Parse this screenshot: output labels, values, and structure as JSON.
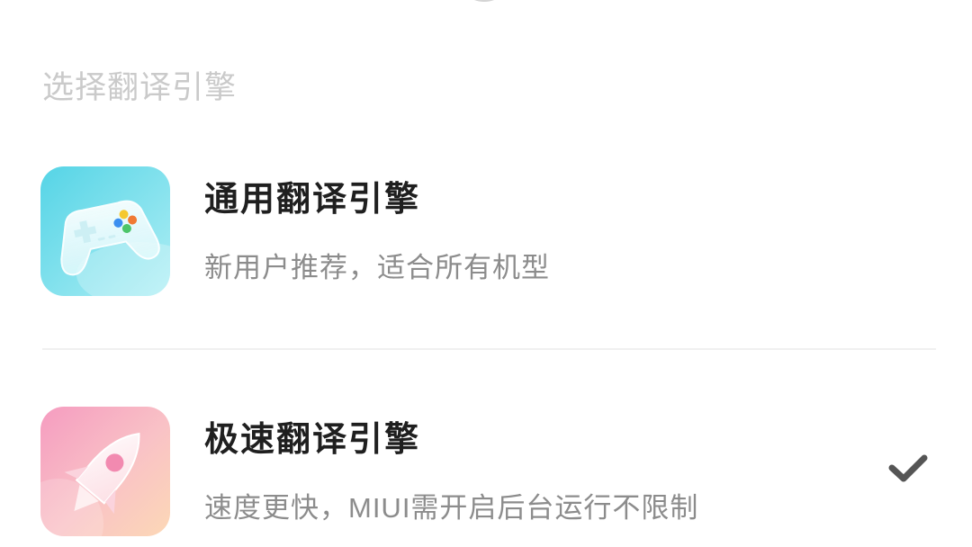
{
  "section_title": "选择翻译引擎",
  "engines": [
    {
      "title": "通用翻译引擎",
      "subtitle": "新用户推荐，适合所有机型",
      "icon": "game-controller-icon",
      "selected": false
    },
    {
      "title": "极速翻译引擎",
      "subtitle": "速度更快，MIUI需开启后台运行不限制",
      "icon": "rocket-icon",
      "selected": true
    }
  ],
  "colors": {
    "background": "#ffffff",
    "section_title": "#cacaca",
    "title": "#1f1f1f",
    "subtitle": "#8c8c8c",
    "divider": "#f0f0f0",
    "checkmark": "#555555",
    "icon_general": "#5fd6e4",
    "icon_fast": "#f6a9c2"
  }
}
